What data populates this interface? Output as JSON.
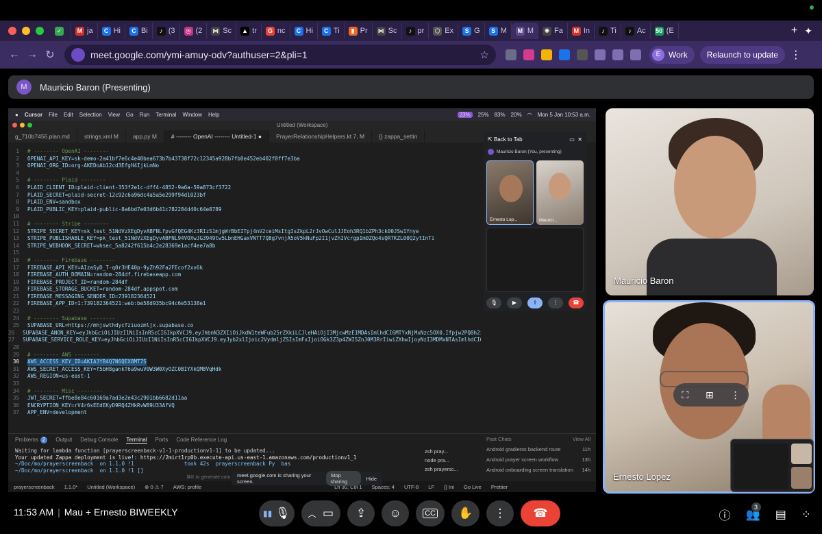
{
  "browser": {
    "tabs": [
      {
        "label": "",
        "color": "#34a853",
        "glyph": "✓"
      },
      {
        "label": "ja",
        "color": "#d93025",
        "glyph": "M"
      },
      {
        "label": "Hi",
        "color": "#1a73e8",
        "glyph": "C"
      },
      {
        "label": "Bi",
        "color": "#1a73e8",
        "glyph": "C"
      },
      {
        "label": "(3",
        "color": "#111111",
        "glyph": "♪"
      },
      {
        "label": "(2",
        "color": "#c13584",
        "glyph": "◎"
      },
      {
        "label": "Sc",
        "color": "#444444",
        "glyph": "⋈"
      },
      {
        "label": "tr",
        "color": "#000000",
        "glyph": "▲"
      },
      {
        "label": "nc",
        "color": "#ea4335",
        "glyph": "G"
      },
      {
        "label": "Hi",
        "color": "#1a73e8",
        "glyph": "C"
      },
      {
        "label": "Ti",
        "color": "#1a73e8",
        "glyph": "C"
      },
      {
        "label": "Pr",
        "color": "#f26522",
        "glyph": "▮"
      },
      {
        "label": "Sc",
        "color": "#444444",
        "glyph": "⋈"
      },
      {
        "label": "pr",
        "color": "#111111",
        "glyph": "♪"
      },
      {
        "label": "Ex",
        "color": "#555555",
        "glyph": "⬡"
      },
      {
        "label": "G",
        "color": "#1a73e8",
        "glyph": "S"
      },
      {
        "label": "M",
        "color": "#1a73e8",
        "glyph": "S"
      },
      {
        "label": "M",
        "color": "#5f4b8b",
        "glyph": "M"
      },
      {
        "label": "Fa",
        "color": "#444444",
        "glyph": "✺"
      },
      {
        "label": "In",
        "color": "#d93025",
        "glyph": "M"
      },
      {
        "label": "Ti",
        "color": "#111111",
        "glyph": "♪"
      },
      {
        "label": "Ac",
        "color": "#111111",
        "glyph": "♪"
      },
      {
        "label": "(E",
        "color": "#0f9d58",
        "glyph": "50"
      }
    ],
    "new_tab": "+",
    "url": "meet.google.com/ymi-amuy-odv?authuser=2&pli=1",
    "profile_initial": "E",
    "profile_label": "Work",
    "relaunch_label": "Relaunch to update"
  },
  "presenter": {
    "initial": "M",
    "text": "Mauricio Baron (Presenting)"
  },
  "shared_screen": {
    "menu": [
      "Cursor",
      "File",
      "Edit",
      "Selection",
      "View",
      "Go",
      "Run",
      "Terminal",
      "Window",
      "Help"
    ],
    "clock": "Mon 5 Jan  10:53 a.m.",
    "battery": "20%",
    "stats": [
      "23%",
      "25%",
      "83%"
    ],
    "window_title": "Untitled (Workspace)",
    "editor_tabs": [
      {
        "label": "g_710b7456.plan.md",
        "active": false
      },
      {
        "label": "strings.xml  M",
        "active": false
      },
      {
        "label": "app.py  M",
        "active": false
      },
      {
        "label": "# -------- OpenAI -------- Untitled-1 ●",
        "active": true
      },
      {
        "label": "PrayerRelationshipHelpers.kt  7, M",
        "active": false
      },
      {
        "label": "{} zappa_settin",
        "active": false
      }
    ],
    "code_lines": [
      {
        "n": "1",
        "text": "# -------- OpenAI --------",
        "type": "comment"
      },
      {
        "n": "2",
        "text": "OPENAI_API_KEY=sk-demo-2a41bf7e6c4e40bea673b7b43738f72c12345a928b7fb0e452eb402f0ff7e3ba",
        "type": "code"
      },
      {
        "n": "3",
        "text": "OPENAI_ORG_ID=org-AKEDoAb12cd3EfgH4IjkLmNo",
        "type": "code"
      },
      {
        "n": "4",
        "text": "",
        "type": "code"
      },
      {
        "n": "5",
        "text": "# -------- Plaid --------",
        "type": "comment"
      },
      {
        "n": "6",
        "text": "PLAID_CLIENT_ID=plaid-client-353f2e1c-dff4-4852-9a6a-59a873cf3722",
        "type": "code"
      },
      {
        "n": "7",
        "text": "PLAID_SECRET=plaid-secret-12c92c6a96dc4a5a5e299f94d1023bf",
        "type": "code"
      },
      {
        "n": "8",
        "text": "PLAID_ENV=sandbox",
        "type": "code"
      },
      {
        "n": "9",
        "text": "PLAID_PUBLIC_KEY=plaid-public-8a6bd7e03d6b41c782284d40c64e8789",
        "type": "code"
      },
      {
        "n": "10",
        "text": "",
        "type": "code"
      },
      {
        "n": "11",
        "text": "# -------- Stripe --------",
        "type": "comment"
      },
      {
        "n": "12",
        "text": "STRIPE_SECRET_KEY=sk_test_51NdVzXEgDyvABFNLfpvGfQEG4Kz3RIzS1mjgWrBbEITpj4nV2ceiMsItgIsZkpL2rJvOwCulJJEoh3RQ1bZPh3ck00JSw1Ynye",
        "type": "code"
      },
      {
        "n": "13",
        "text": "STRIPE_PUBLISHABLE_KEY=pk_test_51NdVzXEgDyvABFNL94VOXwJG3949tw5LbnEHGaxVNTT7Q8g7vnjA5oV5kNuFp2I1jvZhIVcrgpIm0ZQo4sQRTKZL00Q2ytInTi",
        "type": "code"
      },
      {
        "n": "14",
        "text": "STRIPE_WEBHOOK_SECRET=whsec_5a8242f615b4c2e28369e1acf4ee7a8b",
        "type": "code"
      },
      {
        "n": "15",
        "text": "",
        "type": "code"
      },
      {
        "n": "16",
        "text": "# -------- Firebase --------",
        "type": "comment"
      },
      {
        "n": "17",
        "text": "FIREBASE_API_KEY=AIzaSyD_T-q0r3HE40p-9yZh92Fa2FEcof2xv6k",
        "type": "code"
      },
      {
        "n": "18",
        "text": "FIREBASE_AUTH_DOMAIN=random-284df.firebaseapp.com",
        "type": "code"
      },
      {
        "n": "19",
        "text": "FIREBASE_PROJECT_ID=random-284df",
        "type": "code"
      },
      {
        "n": "20",
        "text": "FIREBASE_STORAGE_BUCKET=random-284df.appspot.com",
        "type": "code"
      },
      {
        "n": "21",
        "text": "FIREBASE_MESSAGING_SENDER_ID=739182364521",
        "type": "code"
      },
      {
        "n": "22",
        "text": "FIREBASE_APP_ID=1:739182364521:web:be58d935bc94c6e53138e1",
        "type": "code"
      },
      {
        "n": "23",
        "text": "",
        "type": "code"
      },
      {
        "n": "24",
        "text": "# -------- Supabase --------",
        "type": "comment"
      },
      {
        "n": "25",
        "text": "SUPABASE_URL=https://mhjswthdycfziuozmljx.supabase.co",
        "type": "code"
      },
      {
        "n": "26",
        "text": "SUPABASE_ANON_KEY=eyJhbGciOiJIUzI1NiIsInR5cCI6IkpXVCJ9.eyJhbnN3ZXIiOiJkdW1teWFub25rZXkiLCJleHAiOjI3MjcwMzE1MDAsImlhdCI6MTYxNjMxNzc5OX0.Ifpjw2PQ0h2ivu",
        "type": "code"
      },
      {
        "n": "27",
        "text": "SUPABASE_SERVICE_ROLE_KEY=eyJhbGciOiJIUzI1NiIsInR5cCI6IkpXVCJ9.eyJyb2xlIjoic2VydmljZSIsImFxIjoiOGk3Z3p4ZWI5ZnJ0M3RrIiwiZXhwIjoyNzI3MDMxNTAsImlhdCI6MT",
        "type": "code"
      },
      {
        "n": "28",
        "text": "",
        "type": "code"
      },
      {
        "n": "29",
        "text": "# -------- AWS --------",
        "type": "comment"
      },
      {
        "n": "30",
        "text": "AWS_ACCESS_KEY_ID=AKIA3YB4Q7N6QEX8MT7S",
        "type": "highlight"
      },
      {
        "n": "31",
        "text": "AWS_SECRET_ACCESS_KEY=f5bH8gankT6a9wuV0W3W0XyOZC0BIYXkQM8VqHdk",
        "type": "code"
      },
      {
        "n": "32",
        "text": "AWS_REGION=us-east-1",
        "type": "code"
      },
      {
        "n": "33",
        "text": "",
        "type": "code"
      },
      {
        "n": "34",
        "text": "# -------- Misc --------",
        "type": "comment"
      },
      {
        "n": "35",
        "text": "JWT_SECRET=ffbe8e84c60169a7ad3e2e43c2901bb6682d11aa",
        "type": "code"
      },
      {
        "n": "36",
        "text": "ENCRYPTION_KEY=rV4r6sEEdEKyD9RQ4ZHkRvW89U33AfVQ",
        "type": "code"
      },
      {
        "n": "37",
        "text": "APP_ENV=development",
        "type": "code"
      }
    ],
    "panel_tabs": [
      "Problems",
      "Output",
      "Debug Console",
      "Terminal",
      "Ports",
      "Code Reference Log"
    ],
    "problems_count": "2",
    "terminal_lines": [
      "Waiting for lambda function [prayerscreenback-v1-1-productionv1-1] to be updated...",
      "Your updated Zappa deployment is live!: https://2mirt1rp0b.execute-api.us-east-1.amazonaws.com/productionv1_1",
      "~/Doc/mo/prayerscreenback  on 1.1.0 !1                took 42s  prayerscreenback Py  bas",
      "~/Doc/mo/prayerscreenback  on 1.1.0 !1 []"
    ],
    "terminal_list": [
      "zsh  pray...",
      "node  pra...",
      "zsh  prayersc..."
    ],
    "past_chats_title": "Past Chats",
    "view_all": "View All",
    "past_chats": [
      {
        "title": "Android gradients backend route",
        "time": "11h"
      },
      {
        "title": "Android prayer screen workflow",
        "time": "13h"
      },
      {
        "title": "Android onboarding screen translation",
        "time": "14h"
      }
    ],
    "generate_hint": "⌘K to generate com",
    "share_banner_text": "meet.google.com is sharing your screen.",
    "stop_sharing": "Stop sharing",
    "hide": "Hide",
    "status_items": [
      "prayerscreenback",
      "1.1.0*",
      "Untitled (Workspace)",
      "⊗ 0 ⚠ 7",
      "AWS: profile",
      "Ln 30, Col 1",
      "Spaces: 4",
      "UTF-8",
      "LF",
      "{} Ini",
      "Go Live",
      "Prettier"
    ],
    "pip": {
      "back_to_tab": "Back to Tab",
      "presenting_row": "Mauricio Baron (You, presenting)",
      "tile_names": [
        "Ernesto Lop...",
        "Maurici..."
      ]
    }
  },
  "participants": [
    {
      "name": "Mauricio Baron"
    },
    {
      "name": "Ernesto Lopez"
    }
  ],
  "bottom_bar": {
    "time": "11:53 AM",
    "separator": "|",
    "meeting_name": "Mau + Ernesto BIWEEKLY",
    "people_count": "3"
  },
  "colors": {
    "end_call": "#ea4335",
    "active_speaker": "#8ab4f8",
    "chrome_bg": "#3b2d62"
  }
}
